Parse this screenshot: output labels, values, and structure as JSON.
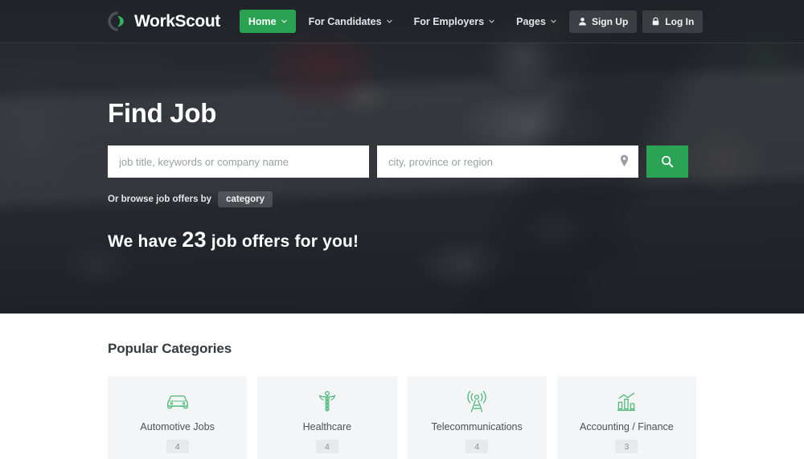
{
  "brand": {
    "name": "WorkScout",
    "accent_color": "#2aa355",
    "logo_icon": "workscout-logo-icon"
  },
  "header": {
    "nav": [
      {
        "label": "Home",
        "active": true,
        "has_caret": true
      },
      {
        "label": "For Candidates",
        "active": false,
        "has_caret": true
      },
      {
        "label": "For Employers",
        "active": false,
        "has_caret": true
      },
      {
        "label": "Pages",
        "active": false,
        "has_caret": true
      }
    ],
    "actions": [
      {
        "label": "Sign Up",
        "icon": "user-icon"
      },
      {
        "label": "Log In",
        "icon": "lock-icon"
      }
    ]
  },
  "hero": {
    "title": "Find Job",
    "keyword_placeholder": "job title, keywords or company name",
    "keyword_value": "",
    "location_placeholder": "city, province or region",
    "location_value": "",
    "location_icon": "map-pin-icon",
    "search_icon": "search-icon",
    "browse_label": "Or browse job offers by",
    "browse_chip": "category",
    "offers_prefix": "We have",
    "offers_count": "23",
    "offers_suffix": "job offers for you!"
  },
  "categories": {
    "title": "Popular Categories",
    "items": [
      {
        "label": "Automotive Jobs",
        "count": "4",
        "icon": "car-icon"
      },
      {
        "label": "Healthcare",
        "count": "4",
        "icon": "caduceus-icon"
      },
      {
        "label": "Telecommunications",
        "count": "4",
        "icon": "broadcast-tower-icon"
      },
      {
        "label": "Accounting / Finance",
        "count": "3",
        "icon": "bar-chart-icon"
      }
    ]
  }
}
